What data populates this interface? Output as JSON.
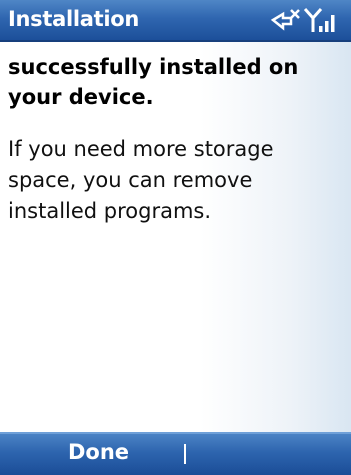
{
  "titlebar": {
    "title": "Installation",
    "icons": [
      "charging-disconnected-icon",
      "no-signal-icon"
    ]
  },
  "content": {
    "heading": "successfully installed on your device.",
    "message": "If you need more storage space, you can remove installed programs."
  },
  "softkeys": {
    "left_label": "Done",
    "right_label": ""
  },
  "colors": {
    "titlebar": "#2f66b0",
    "softkey_bar": "#2d64ae",
    "text": "#000000"
  }
}
